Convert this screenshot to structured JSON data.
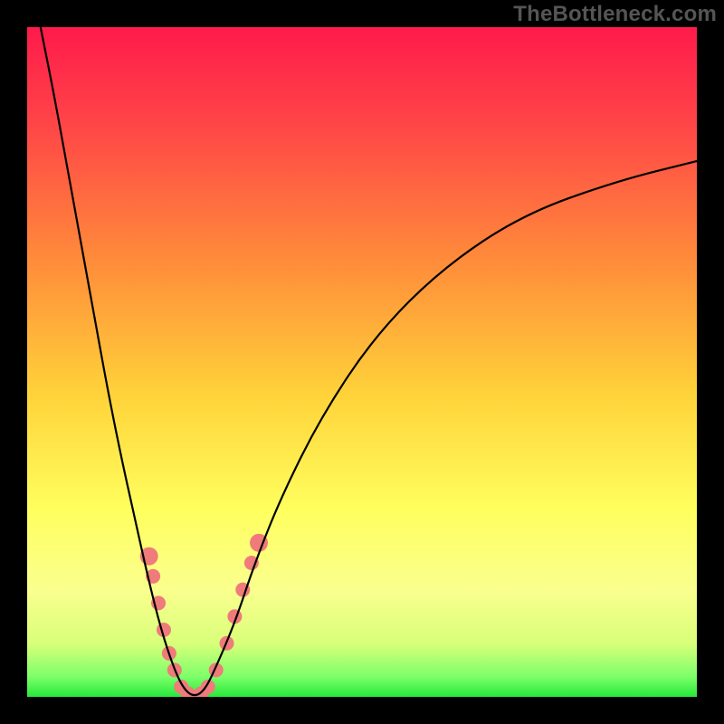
{
  "watermark": "TheBottleneck.com",
  "chart_data": {
    "type": "line",
    "title": "",
    "xlabel": "",
    "ylabel": "",
    "xlim": [
      0,
      100
    ],
    "ylim": [
      0,
      100
    ],
    "gradient_stops": [
      {
        "pct": 0,
        "color": "#ff1a4b"
      },
      {
        "pct": 15,
        "color": "#ff4747"
      },
      {
        "pct": 35,
        "color": "#ff8c3a"
      },
      {
        "pct": 55,
        "color": "#ffd33a"
      },
      {
        "pct": 72,
        "color": "#ffff5e"
      },
      {
        "pct": 84,
        "color": "#faff8e"
      },
      {
        "pct": 92,
        "color": "#d9ff7a"
      },
      {
        "pct": 97,
        "color": "#7dff6a"
      },
      {
        "pct": 100,
        "color": "#27e83b"
      }
    ],
    "series": [
      {
        "name": "bottleneck-curve",
        "color": "#000000",
        "x": [
          2,
          4,
          6,
          8,
          10,
          12,
          14,
          16,
          18,
          20,
          22,
          23.5,
          25,
          26.5,
          28,
          31,
          34,
          38,
          44,
          52,
          62,
          74,
          88,
          100
        ],
        "y": [
          100,
          90,
          79,
          68,
          57,
          46,
          36,
          27,
          18,
          10,
          4,
          1,
          0,
          1,
          4,
          11,
          20,
          30,
          42,
          54,
          64,
          72,
          77,
          80
        ]
      }
    ],
    "markers": {
      "name": "highlight-dots",
      "color": "#ef7b7b",
      "radius_small": 6,
      "radius_large": 10,
      "points": [
        {
          "x": 18.2,
          "y": 21.0,
          "r": 10
        },
        {
          "x": 18.8,
          "y": 18.0,
          "r": 8
        },
        {
          "x": 19.6,
          "y": 14.0,
          "r": 8
        },
        {
          "x": 20.4,
          "y": 10.0,
          "r": 8
        },
        {
          "x": 21.2,
          "y": 6.5,
          "r": 8
        },
        {
          "x": 22.0,
          "y": 4.0,
          "r": 8
        },
        {
          "x": 23.0,
          "y": 1.5,
          "r": 8
        },
        {
          "x": 24.0,
          "y": 0.5,
          "r": 8
        },
        {
          "x": 25.0,
          "y": 0.0,
          "r": 8
        },
        {
          "x": 26.0,
          "y": 0.5,
          "r": 8
        },
        {
          "x": 27.0,
          "y": 1.5,
          "r": 8
        },
        {
          "x": 28.2,
          "y": 4.0,
          "r": 8
        },
        {
          "x": 29.8,
          "y": 8.0,
          "r": 8
        },
        {
          "x": 31.0,
          "y": 12.0,
          "r": 8
        },
        {
          "x": 32.2,
          "y": 16.0,
          "r": 8
        },
        {
          "x": 33.5,
          "y": 20.0,
          "r": 8
        },
        {
          "x": 34.6,
          "y": 23.0,
          "r": 10
        }
      ]
    }
  }
}
